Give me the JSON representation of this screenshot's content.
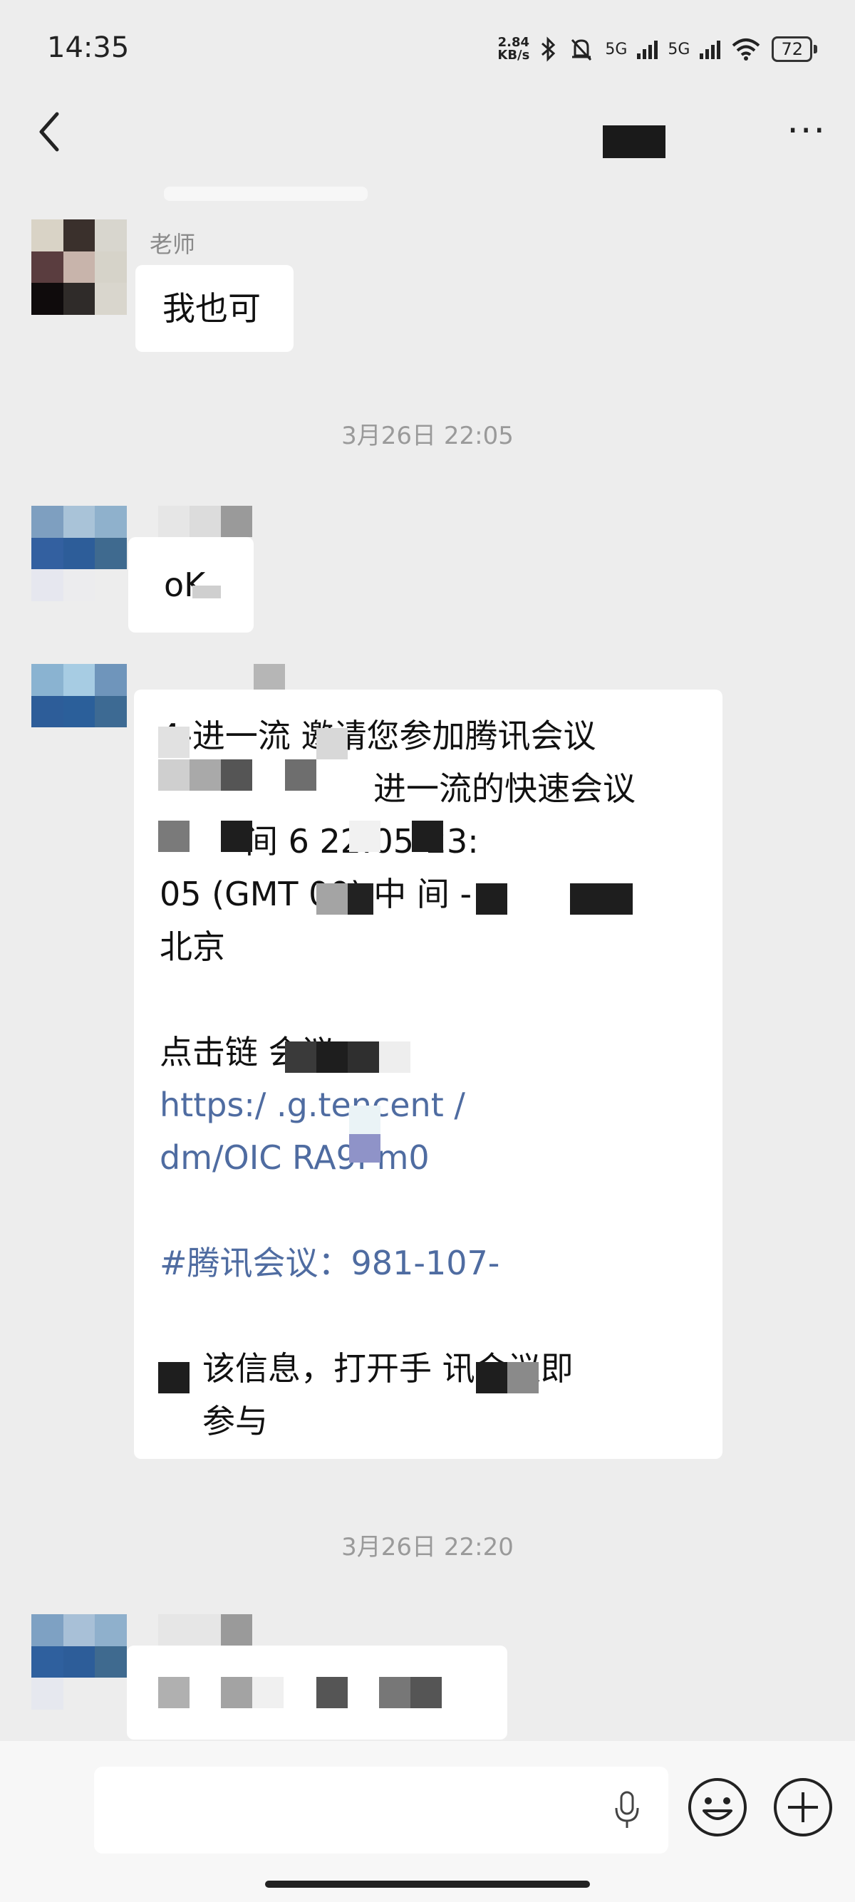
{
  "status_bar": {
    "time": "14:35",
    "speed_top": "2.84",
    "speed_bottom": "KB/s",
    "net1": "5G",
    "net2": "5G",
    "battery": "72",
    "icons": [
      "bluetooth-icon",
      "mute-bell-icon",
      "signal-icon",
      "wifi-icon",
      "battery-icon"
    ]
  },
  "nav": {
    "back_icon": "chevron-left-icon",
    "more_label": "···"
  },
  "messages": [
    {
      "sender_partial": "老师",
      "text": "我也可"
    },
    {
      "timestamp": "3月26日 22:05"
    },
    {
      "text": "oK"
    },
    {
      "lines": [
        "4-进一流 邀请您参加腾讯会议",
        "进一流的快速会议",
        "间 6 22:05-23:",
        "05 (GMT 00) 中 间 -",
        "北京",
        "",
        "点击链 会议：",
        "https:/ .g.tencent /",
        "dm/OIC RA9Pm0",
        "",
        "#腾讯会议：981-107-",
        "",
        "该信息，打开手 讯会议即",
        "参与"
      ]
    },
    {
      "timestamp": "3月26日 22:20"
    }
  ],
  "input": {
    "mic_icon": "microphone-icon",
    "emoji_icon": "emoji-icon",
    "plus_icon": "plus-icon"
  },
  "colors": {
    "background": "#ededed",
    "bubble": "#ffffff",
    "link": "#4f6ca1",
    "timestamp": "#9a9a9a"
  }
}
